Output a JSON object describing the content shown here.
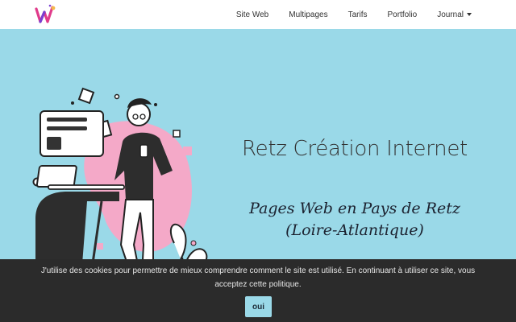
{
  "header": {
    "nav": [
      {
        "label": "Site Web"
      },
      {
        "label": "Multipages"
      },
      {
        "label": "Tarifs"
      },
      {
        "label": "Portfolio"
      },
      {
        "label": "Journal"
      }
    ]
  },
  "hero": {
    "title": "Retz Création Internet",
    "subtitle_line1": "Pages Web en Pays de Retz",
    "subtitle_line2": "(Loire-Atlantique)"
  },
  "cookie_banner": {
    "text": "J'utilise des cookies pour permettre de mieux comprendre comment le site est utilisé. En continuant à utiliser ce site, vous acceptez cette politique.",
    "accept_label": "oui"
  },
  "colors": {
    "hero_background": "#9ad9e8",
    "blob_pink": "#f4a9c8",
    "cookie_background": "#2b2b2b",
    "logo_pink": "#e03b8b",
    "logo_purple": "#7a3fd1"
  },
  "icons": [
    "logo-w-icon",
    "caret-down-icon"
  ]
}
